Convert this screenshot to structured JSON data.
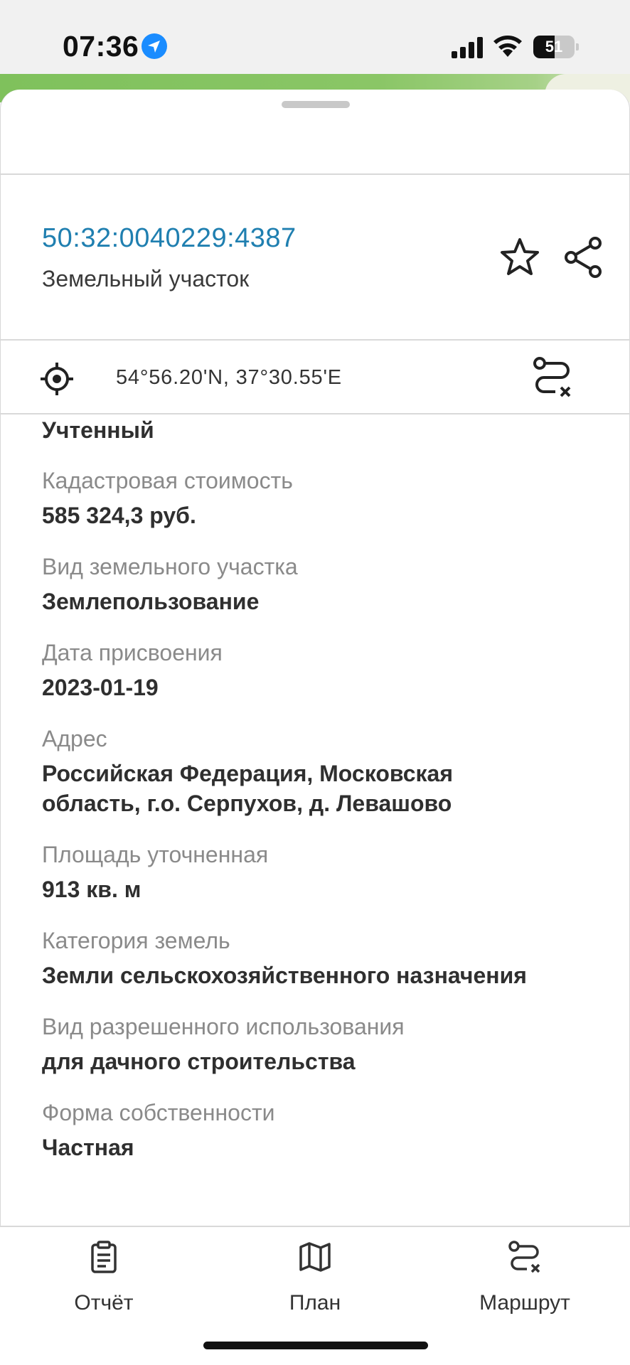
{
  "status_bar": {
    "time": "07:36",
    "battery": "51",
    "battery_level": 0.51
  },
  "header": {
    "cadastral_number": "50:32:0040229:4387",
    "object_type": "Земельный участок"
  },
  "location": {
    "coordinates": "54°56.20'N, 37°30.55'E"
  },
  "properties": {
    "status_value": "Учтенный",
    "items": [
      {
        "label": "Кадастровая стоимость",
        "value": "585 324,3 руб."
      },
      {
        "label": "Вид земельного участка",
        "value": "Землепользование"
      },
      {
        "label": "Дата присвоения",
        "value": "2023-01-19"
      },
      {
        "label": "Адрес",
        "value_line1": "Российская Федерация, Московская",
        "value_line2": "область, г.о. Серпухов, д. Левашово"
      },
      {
        "label": "Площадь уточненная",
        "value": "913 кв. м"
      },
      {
        "label": "Категория земель",
        "value": "Земли сельскохозяйственного назначения"
      },
      {
        "label": "Вид разрешенного использования",
        "value": "для дачного строительства"
      },
      {
        "label": "Форма собственности",
        "value": "Частная"
      }
    ]
  },
  "bottom_nav": {
    "items": [
      {
        "label": "Отчёт",
        "icon": "clipboard-icon"
      },
      {
        "label": "План",
        "icon": "map-icon"
      },
      {
        "label": "Маршрут",
        "icon": "route-icon"
      }
    ]
  },
  "colors": {
    "link": "#1f7fb0",
    "label_gray": "#8a8a8a",
    "map_green": "#7fc15c"
  }
}
